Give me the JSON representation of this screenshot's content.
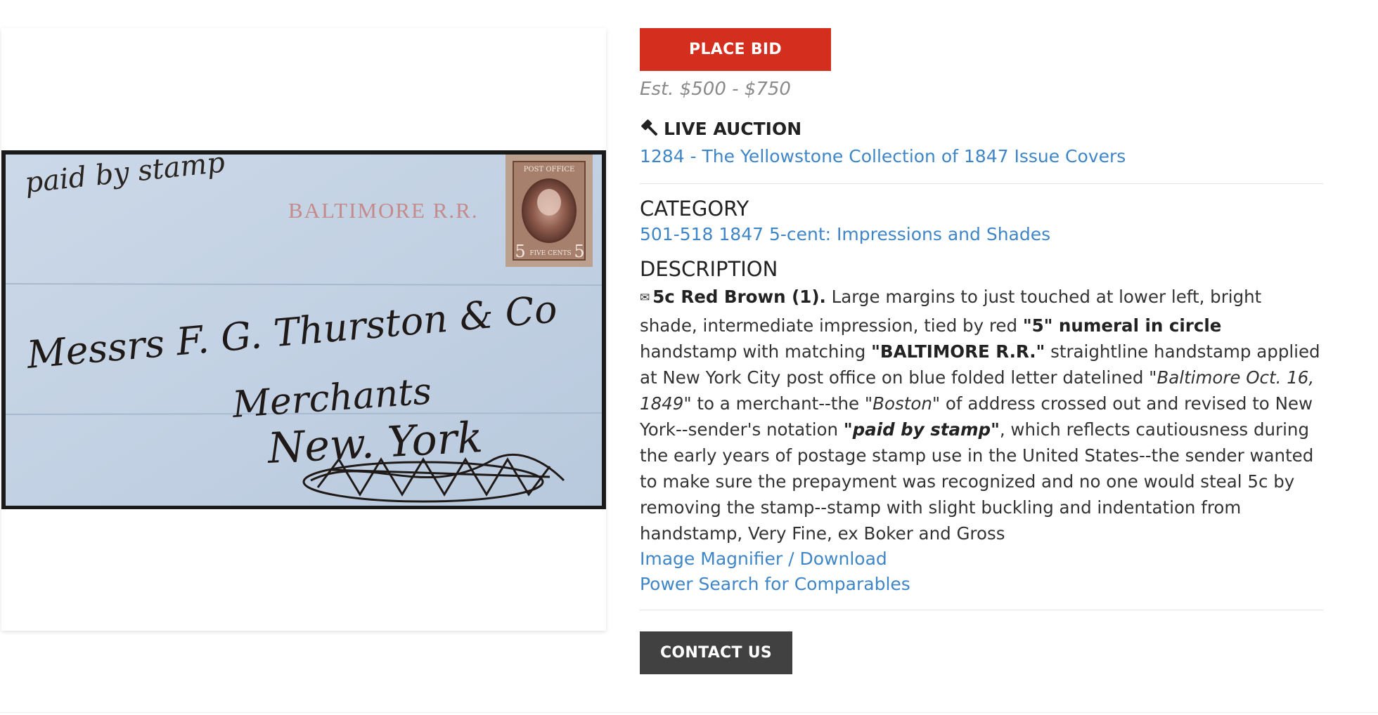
{
  "lot": {
    "place_bid_label": "PLACE BID",
    "estimate": "Est. $500 - $750",
    "live_auction_label": "LIVE AUCTION",
    "auction_link": "1284 - The Yellowstone Collection of 1847 Issue Covers",
    "category_heading": "CATEGORY",
    "category_link": "501-518 1847 5-cent: Impressions and Shades",
    "description_heading": "DESCRIPTION",
    "description": {
      "envelope_icon": "✉",
      "p1": "5c Red Brown (1).",
      "p2": " Large margins to just touched at lower left, bright shade, intermediate impression, tied by red ",
      "p3": "\"5\" numeral in circle",
      "p4": " handstamp with matching ",
      "p5": "\"BALTIMORE R.R.\"",
      "p6": " straightline handstamp applied at New York City post office on blue folded letter datelined ",
      "p7": "\"Baltimore Oct. 16, 1849\"",
      "p8": " to a merchant--the ",
      "p9": "\"Boston\"",
      "p10": " of address crossed out and revised to New York--sender's notation ",
      "p11": "\"paid by stamp\"",
      "p12": ", which reflects cautiousness during the early years of postage stamp use in the United States--the sender wanted to make sure the prepayment was recognized and no one would steal 5c by removing the stamp--stamp with slight buckling and indentation from handstamp, Very Fine, ex Boker and Gross"
    },
    "image_magnifier_link": "Image Magnifier / Download",
    "power_search_link": "Power Search for Comparables",
    "contact_label": "CONTACT US"
  },
  "cover_image": {
    "notation": "paid by stamp",
    "handstamp": "BALTIMORE R.R.",
    "stamp_top": "POST OFFICE",
    "stamp_bottom": "FIVE CENTS",
    "stamp_numeral": "5",
    "address_line1": "Messrs F. G. Thurston & Co",
    "address_line2": "Merchants",
    "address_line3": "New. York"
  },
  "colors": {
    "bid_button": "#d42e1f",
    "contact_button": "#414141",
    "link": "#3f86c8",
    "estimate": "#8a8a8a",
    "cover_paper": "#c4d3e4",
    "handstamp_red": "#c47f7c"
  },
  "icons": {
    "gavel": "gavel-icon",
    "envelope": "envelope-icon"
  }
}
